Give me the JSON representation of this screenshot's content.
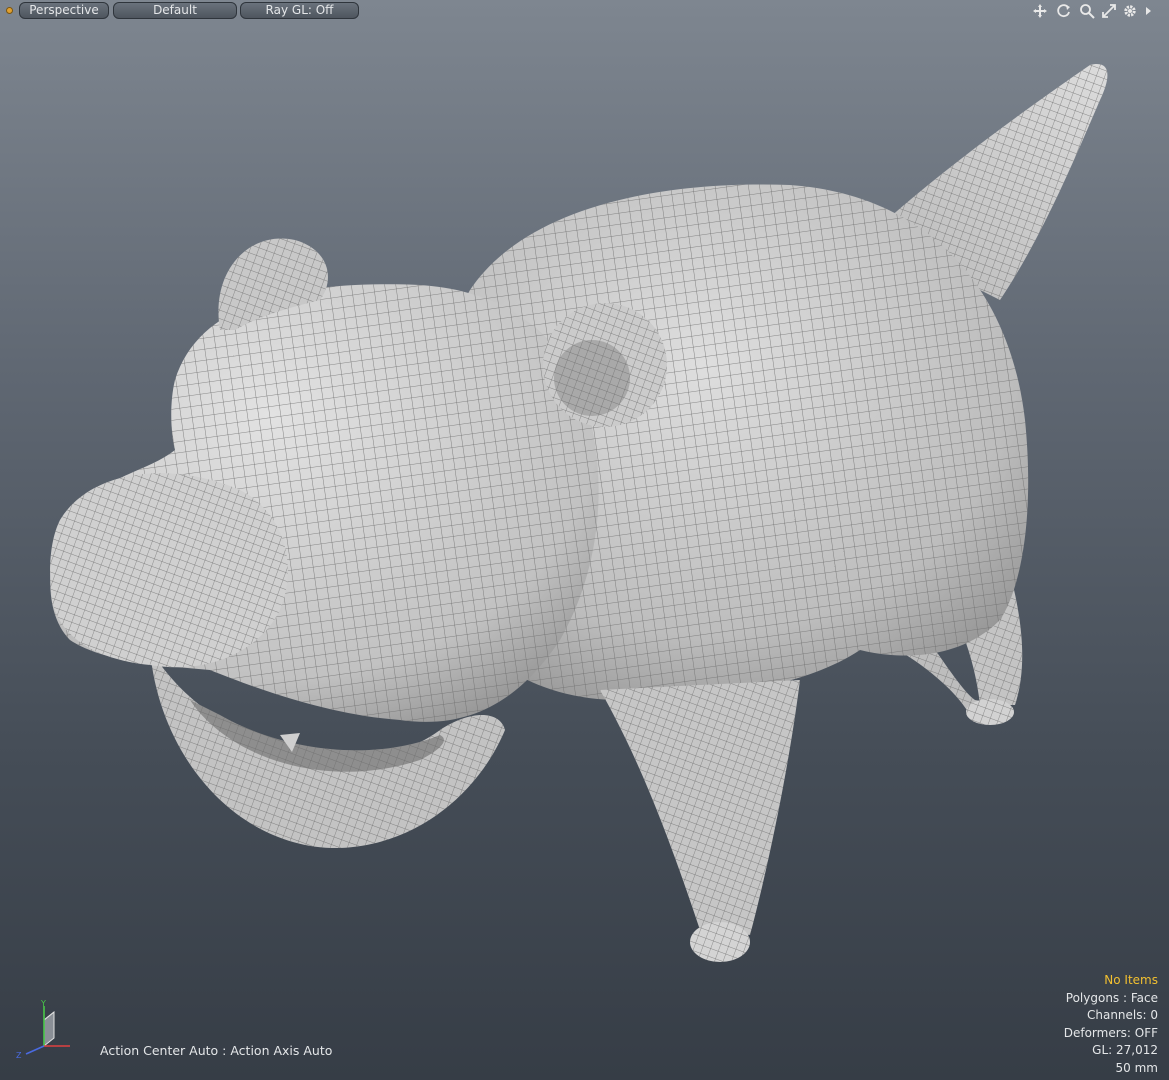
{
  "viewport": {
    "projection_label": "Perspective",
    "style_label": "Default",
    "raygl_label": "Ray GL: Off"
  },
  "hud": {
    "selection": "No Items",
    "polygons": "Polygons : Face",
    "channels": "Channels: 0",
    "deformers": "Deformers: OFF",
    "gl": "GL: 27,012",
    "focal": "50 mm"
  },
  "status": {
    "action": "Action Center Auto : Action Axis Auto"
  },
  "colors": {
    "accent_selection": "#f2c030",
    "hud_text": "#e4e6e8",
    "mesh": "#cfcfcf"
  },
  "icons": [
    "pan-icon",
    "rotate-icon",
    "zoom-icon",
    "maximize-icon",
    "settings-icon",
    "expand-arrow-icon"
  ]
}
